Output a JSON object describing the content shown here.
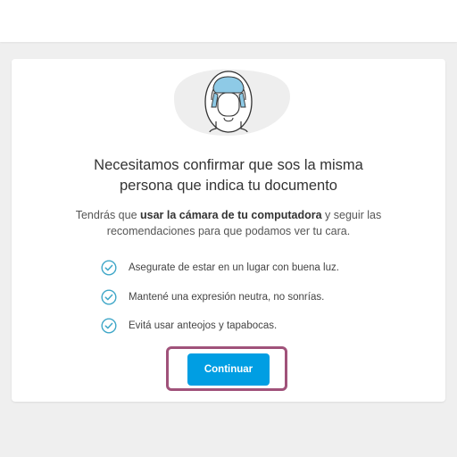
{
  "header": {},
  "illustration": {
    "icon": "face-avatar-icon"
  },
  "card": {
    "title_line1": "Necesitamos confirmar que sos la misma",
    "title_line2": "persona que indica tu documento",
    "subtitle_pre": "Tendrás que ",
    "subtitle_bold": "usar la cámara de tu computadora",
    "subtitle_post": " y seguir las",
    "subtitle_line2": "recomendaciones para que podamos ver tu cara.",
    "tips": [
      {
        "text": "Asegurate de estar en un lugar con buena luz.",
        "icon": "check-circle-icon"
      },
      {
        "text": "Mantené una expresión neutra, no sonrías.",
        "icon": "check-circle-icon"
      },
      {
        "text": "Evitá usar anteojos y tapabocas.",
        "icon": "check-circle-icon"
      }
    ],
    "continue_label": "Continuar"
  },
  "colors": {
    "accent": "#009ee3",
    "check": "#3fa7c8",
    "highlight": "#a0527a",
    "avatar_hair": "#8ecae6",
    "background": "#efefef"
  }
}
